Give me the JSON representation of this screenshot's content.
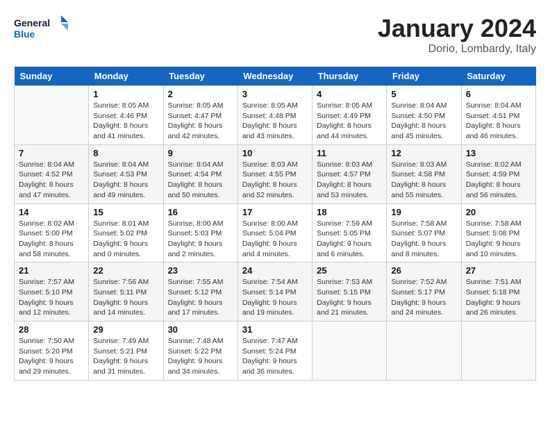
{
  "header": {
    "logo_line1": "General",
    "logo_line2": "Blue",
    "title": "January 2024",
    "subtitle": "Dorio, Lombardy, Italy"
  },
  "weekdays": [
    "Sunday",
    "Monday",
    "Tuesday",
    "Wednesday",
    "Thursday",
    "Friday",
    "Saturday"
  ],
  "weeks": [
    [
      {
        "day": "",
        "info": ""
      },
      {
        "day": "1",
        "info": "Sunrise: 8:05 AM\nSunset: 4:46 PM\nDaylight: 8 hours\nand 41 minutes."
      },
      {
        "day": "2",
        "info": "Sunrise: 8:05 AM\nSunset: 4:47 PM\nDaylight: 8 hours\nand 42 minutes."
      },
      {
        "day": "3",
        "info": "Sunrise: 8:05 AM\nSunset: 4:48 PM\nDaylight: 8 hours\nand 43 minutes."
      },
      {
        "day": "4",
        "info": "Sunrise: 8:05 AM\nSunset: 4:49 PM\nDaylight: 8 hours\nand 44 minutes."
      },
      {
        "day": "5",
        "info": "Sunrise: 8:04 AM\nSunset: 4:50 PM\nDaylight: 8 hours\nand 45 minutes."
      },
      {
        "day": "6",
        "info": "Sunrise: 8:04 AM\nSunset: 4:51 PM\nDaylight: 8 hours\nand 46 minutes."
      }
    ],
    [
      {
        "day": "7",
        "info": "Sunrise: 8:04 AM\nSunset: 4:52 PM\nDaylight: 8 hours\nand 47 minutes."
      },
      {
        "day": "8",
        "info": "Sunrise: 8:04 AM\nSunset: 4:53 PM\nDaylight: 8 hours\nand 49 minutes."
      },
      {
        "day": "9",
        "info": "Sunrise: 8:04 AM\nSunset: 4:54 PM\nDaylight: 8 hours\nand 50 minutes."
      },
      {
        "day": "10",
        "info": "Sunrise: 8:03 AM\nSunset: 4:55 PM\nDaylight: 8 hours\nand 52 minutes."
      },
      {
        "day": "11",
        "info": "Sunrise: 8:03 AM\nSunset: 4:57 PM\nDaylight: 8 hours\nand 53 minutes."
      },
      {
        "day": "12",
        "info": "Sunrise: 8:03 AM\nSunset: 4:58 PM\nDaylight: 8 hours\nand 55 minutes."
      },
      {
        "day": "13",
        "info": "Sunrise: 8:02 AM\nSunset: 4:59 PM\nDaylight: 8 hours\nand 56 minutes."
      }
    ],
    [
      {
        "day": "14",
        "info": "Sunrise: 8:02 AM\nSunset: 5:00 PM\nDaylight: 8 hours\nand 58 minutes."
      },
      {
        "day": "15",
        "info": "Sunrise: 8:01 AM\nSunset: 5:02 PM\nDaylight: 9 hours\nand 0 minutes."
      },
      {
        "day": "16",
        "info": "Sunrise: 8:00 AM\nSunset: 5:03 PM\nDaylight: 9 hours\nand 2 minutes."
      },
      {
        "day": "17",
        "info": "Sunrise: 8:00 AM\nSunset: 5:04 PM\nDaylight: 9 hours\nand 4 minutes."
      },
      {
        "day": "18",
        "info": "Sunrise: 7:59 AM\nSunset: 5:05 PM\nDaylight: 9 hours\nand 6 minutes."
      },
      {
        "day": "19",
        "info": "Sunrise: 7:58 AM\nSunset: 5:07 PM\nDaylight: 9 hours\nand 8 minutes."
      },
      {
        "day": "20",
        "info": "Sunrise: 7:58 AM\nSunset: 5:08 PM\nDaylight: 9 hours\nand 10 minutes."
      }
    ],
    [
      {
        "day": "21",
        "info": "Sunrise: 7:57 AM\nSunset: 5:10 PM\nDaylight: 9 hours\nand 12 minutes."
      },
      {
        "day": "22",
        "info": "Sunrise: 7:56 AM\nSunset: 5:11 PM\nDaylight: 9 hours\nand 14 minutes."
      },
      {
        "day": "23",
        "info": "Sunrise: 7:55 AM\nSunset: 5:12 PM\nDaylight: 9 hours\nand 17 minutes."
      },
      {
        "day": "24",
        "info": "Sunrise: 7:54 AM\nSunset: 5:14 PM\nDaylight: 9 hours\nand 19 minutes."
      },
      {
        "day": "25",
        "info": "Sunrise: 7:53 AM\nSunset: 5:15 PM\nDaylight: 9 hours\nand 21 minutes."
      },
      {
        "day": "26",
        "info": "Sunrise: 7:52 AM\nSunset: 5:17 PM\nDaylight: 9 hours\nand 24 minutes."
      },
      {
        "day": "27",
        "info": "Sunrise: 7:51 AM\nSunset: 5:18 PM\nDaylight: 9 hours\nand 26 minutes."
      }
    ],
    [
      {
        "day": "28",
        "info": "Sunrise: 7:50 AM\nSunset: 5:20 PM\nDaylight: 9 hours\nand 29 minutes."
      },
      {
        "day": "29",
        "info": "Sunrise: 7:49 AM\nSunset: 5:21 PM\nDaylight: 9 hours\nand 31 minutes."
      },
      {
        "day": "30",
        "info": "Sunrise: 7:48 AM\nSunset: 5:22 PM\nDaylight: 9 hours\nand 34 minutes."
      },
      {
        "day": "31",
        "info": "Sunrise: 7:47 AM\nSunset: 5:24 PM\nDaylight: 9 hours\nand 36 minutes."
      },
      {
        "day": "",
        "info": ""
      },
      {
        "day": "",
        "info": ""
      },
      {
        "day": "",
        "info": ""
      }
    ]
  ]
}
